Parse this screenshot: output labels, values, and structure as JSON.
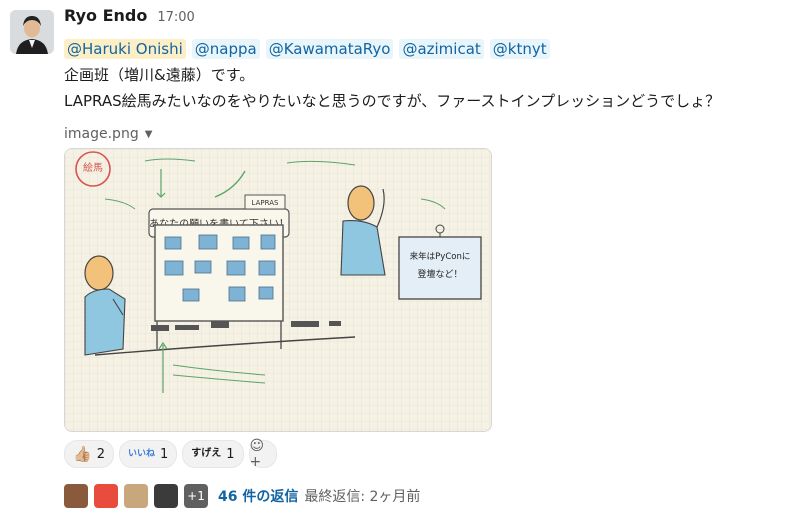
{
  "author": {
    "name": "Ryo Endo",
    "time": "17:00"
  },
  "mentions": [
    "@Haruki Onishi",
    "@nappa",
    "@KawamataRyo",
    "@azimicat",
    "@ktnyt"
  ],
  "message": {
    "line1": "企画班（増川&遠藤）です。",
    "line2": "LAPRAS絵馬みたいなのをやりたいなと思うのですが、ファーストインプレッションどうでしょ？"
  },
  "file": {
    "name": "image.png",
    "caret": "▼"
  },
  "sketch": {
    "stamp": "絵馬",
    "board_title": "あなたの願いを書いて下さい！",
    "board_tag": "LAPRAS",
    "sign_text_line1": "来年はPyConに",
    "sign_text_line2": "登壇など！"
  },
  "reactions": [
    {
      "emoji": "👍🏼",
      "count": "2"
    },
    {
      "emoji": "いいね",
      "count": "1"
    },
    {
      "emoji": "すげえ",
      "count": "1"
    }
  ],
  "add_reaction_icon": "☺+",
  "replies": {
    "more": "+1",
    "count_label": "46 件の返信",
    "last_reply": "最終返信: 2ヶ月前"
  }
}
